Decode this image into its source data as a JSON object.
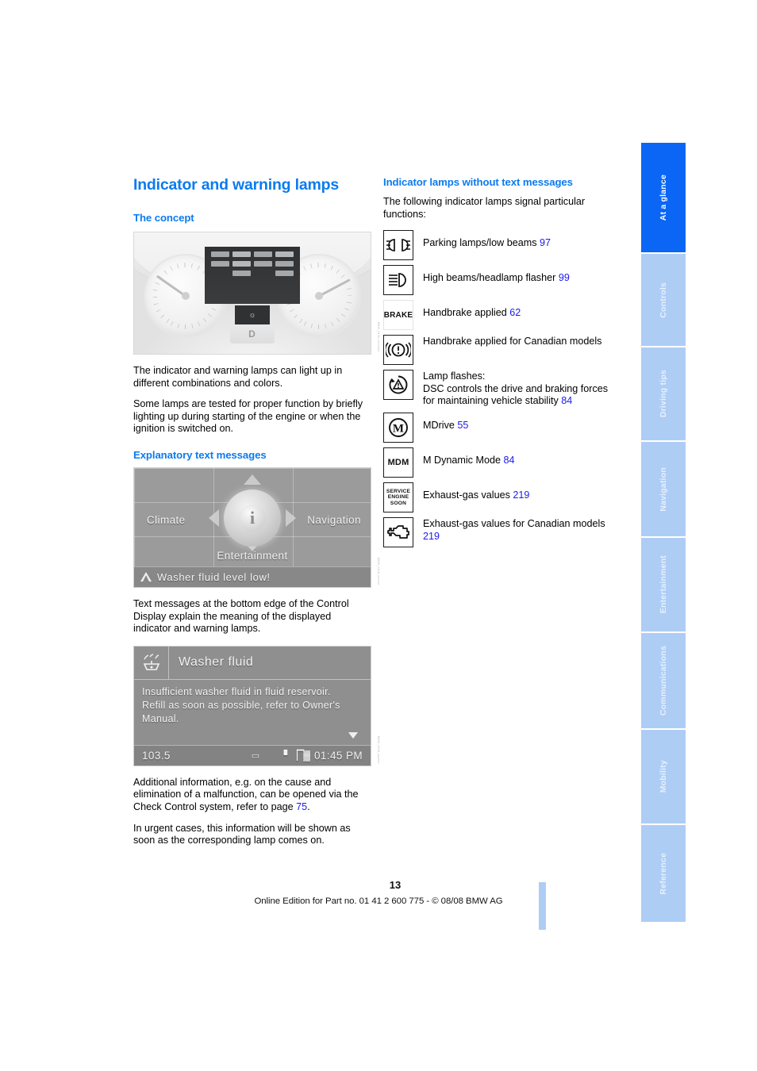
{
  "document": {
    "page_number": "13",
    "footer": "Online Edition for Part no. 01 41 2 600 775 - © 08/08 BMW AG"
  },
  "left_column": {
    "title": "Indicator and warning lamps",
    "concept_heading": "The concept",
    "cluster_figure": {
      "name": "instrument-cluster-photo",
      "gear_badge": "D",
      "caption": "BMW_0408_indicator"
    },
    "concept_paragraphs": [
      "The indicator and warning lamps can light up in different combinations and colors.",
      "Some lamps are tested for proper function by briefly lighting up during starting of the engine or when the ignition is switched on."
    ],
    "explanatory_heading": "Explanatory text messages",
    "idrive_figure": {
      "name": "idrive-main-menu",
      "tiles": {
        "climate": "Climate",
        "navigation": "Navigation",
        "entertainment": "Entertainment",
        "center_icon": "i"
      },
      "status_message": "Washer fluid level low!",
      "caption": "BMW_0408_control"
    },
    "idrive_paragraph": "Text messages at the bottom edge of the Control Display explain the meaning of the displayed indicator and warning lamps.",
    "washer_figure": {
      "name": "washer-fluid-message-screen",
      "title": "Washer fluid",
      "message": "Insufficient washer fluid in fluid reservoir.\nRefill as soon as possible, refer to Owner's Manual.",
      "status_frequency": "103.5",
      "status_time": "01:45 PM",
      "caption": "BMW_0408_washer"
    },
    "closing_paragraphs": [
      {
        "before": "Additional information, e.g. on the cause and elimination of a malfunction, can be opened via the Check Control system, refer to page ",
        "ref": "75",
        "after": "."
      },
      {
        "before": "In urgent cases, this information will be shown as soon as the corresponding lamp comes on.",
        "ref": "",
        "after": ""
      }
    ]
  },
  "right_column": {
    "heading": "Indicator lamps without text messages",
    "intro": "The following indicator lamps signal particular functions:",
    "lamps": [
      {
        "icon": "parking-lamps-low-beams-icon",
        "label": "Parking lamps/low beams",
        "page": "97"
      },
      {
        "icon": "high-beams-headlamp-flasher-icon",
        "label": "High beams/headlamp flasher",
        "page": "99"
      },
      {
        "icon": "brake-text-icon",
        "icon_text": "BRAKE",
        "label": "Handbrake applied",
        "page": "62"
      },
      {
        "icon": "handbrake-canadian-icon",
        "label": "Handbrake applied for Canadian models",
        "page": ""
      },
      {
        "icon": "dsc-triangle-icon",
        "label": "Lamp flashes:\nDSC controls the drive and braking forces for maintaining vehicle stability",
        "page": "84"
      },
      {
        "icon": "mdrive-icon",
        "label": "MDrive",
        "page": "55"
      },
      {
        "icon": "mdm-icon",
        "icon_text": "MDM",
        "label": "M Dynamic Mode",
        "page": "84"
      },
      {
        "icon": "service-engine-soon-icon",
        "icon_text": "SERVICE ENGINE SOON",
        "label": "Exhaust-gas values",
        "page": "219"
      },
      {
        "icon": "check-engine-icon",
        "label": "Exhaust-gas values for Canadian models",
        "page": "219"
      }
    ]
  },
  "sidebar": {
    "tabs": [
      {
        "label": "At a glance",
        "active": true
      },
      {
        "label": "Controls",
        "active": false
      },
      {
        "label": "Driving tips",
        "active": false
      },
      {
        "label": "Navigation",
        "active": false
      },
      {
        "label": "Entertainment",
        "active": false
      },
      {
        "label": "Communications",
        "active": false
      },
      {
        "label": "Mobility",
        "active": false
      },
      {
        "label": "Reference",
        "active": false
      }
    ]
  },
  "colors": {
    "heading_blue": "#0b7bef",
    "reference_blue": "#1a1aee",
    "tab_active": "#0b66f5",
    "tab_idle": "#aecdf5"
  }
}
